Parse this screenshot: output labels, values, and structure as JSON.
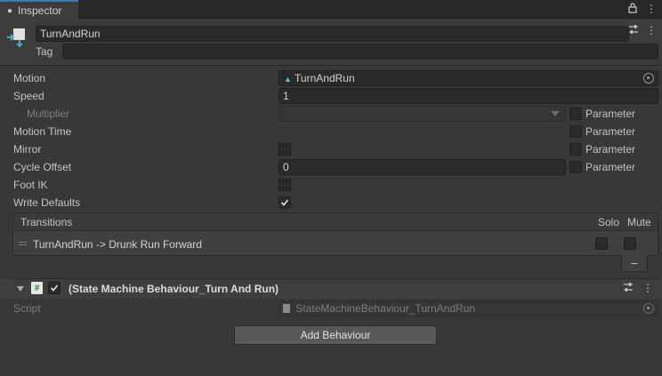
{
  "tab": {
    "title": "Inspector",
    "icon": "info-icon"
  },
  "header": {
    "name": "TurnAndRun",
    "tag_label": "Tag",
    "tag_value": ""
  },
  "fields": {
    "motion": {
      "label": "Motion",
      "value": "TurnAndRun",
      "icon": "animation-clip-icon"
    },
    "speed": {
      "label": "Speed",
      "value": "1"
    },
    "multiplier": {
      "label": "Multiplier",
      "value": "",
      "param_label": "Parameter",
      "param_checked": false
    },
    "motion_time": {
      "label": "Motion Time",
      "param_label": "Parameter",
      "param_checked": false
    },
    "mirror": {
      "label": "Mirror",
      "checked": false,
      "param_label": "Parameter",
      "param_checked": false
    },
    "cycle_offset": {
      "label": "Cycle Offset",
      "value": "0",
      "param_label": "Parameter",
      "param_checked": false
    },
    "foot_ik": {
      "label": "Foot IK",
      "checked": false
    },
    "write_defaults": {
      "label": "Write Defaults",
      "checked": true
    }
  },
  "transitions": {
    "header": "Transitions",
    "solo_label": "Solo",
    "mute_label": "Mute",
    "items": [
      {
        "label": "TurnAndRun -> Drunk Run Forward",
        "solo": false,
        "mute": false
      }
    ],
    "remove_label": "−"
  },
  "behaviour": {
    "title": "(State Machine Behaviour_Turn And Run)",
    "enabled": true,
    "script_label": "Script",
    "script_value": "StateMachineBehaviour_TurnAndRun"
  },
  "add_behaviour_label": "Add Behaviour",
  "colors": {
    "accent": "#3a79bb",
    "background": "#383838",
    "field": "#2a2a2a"
  }
}
